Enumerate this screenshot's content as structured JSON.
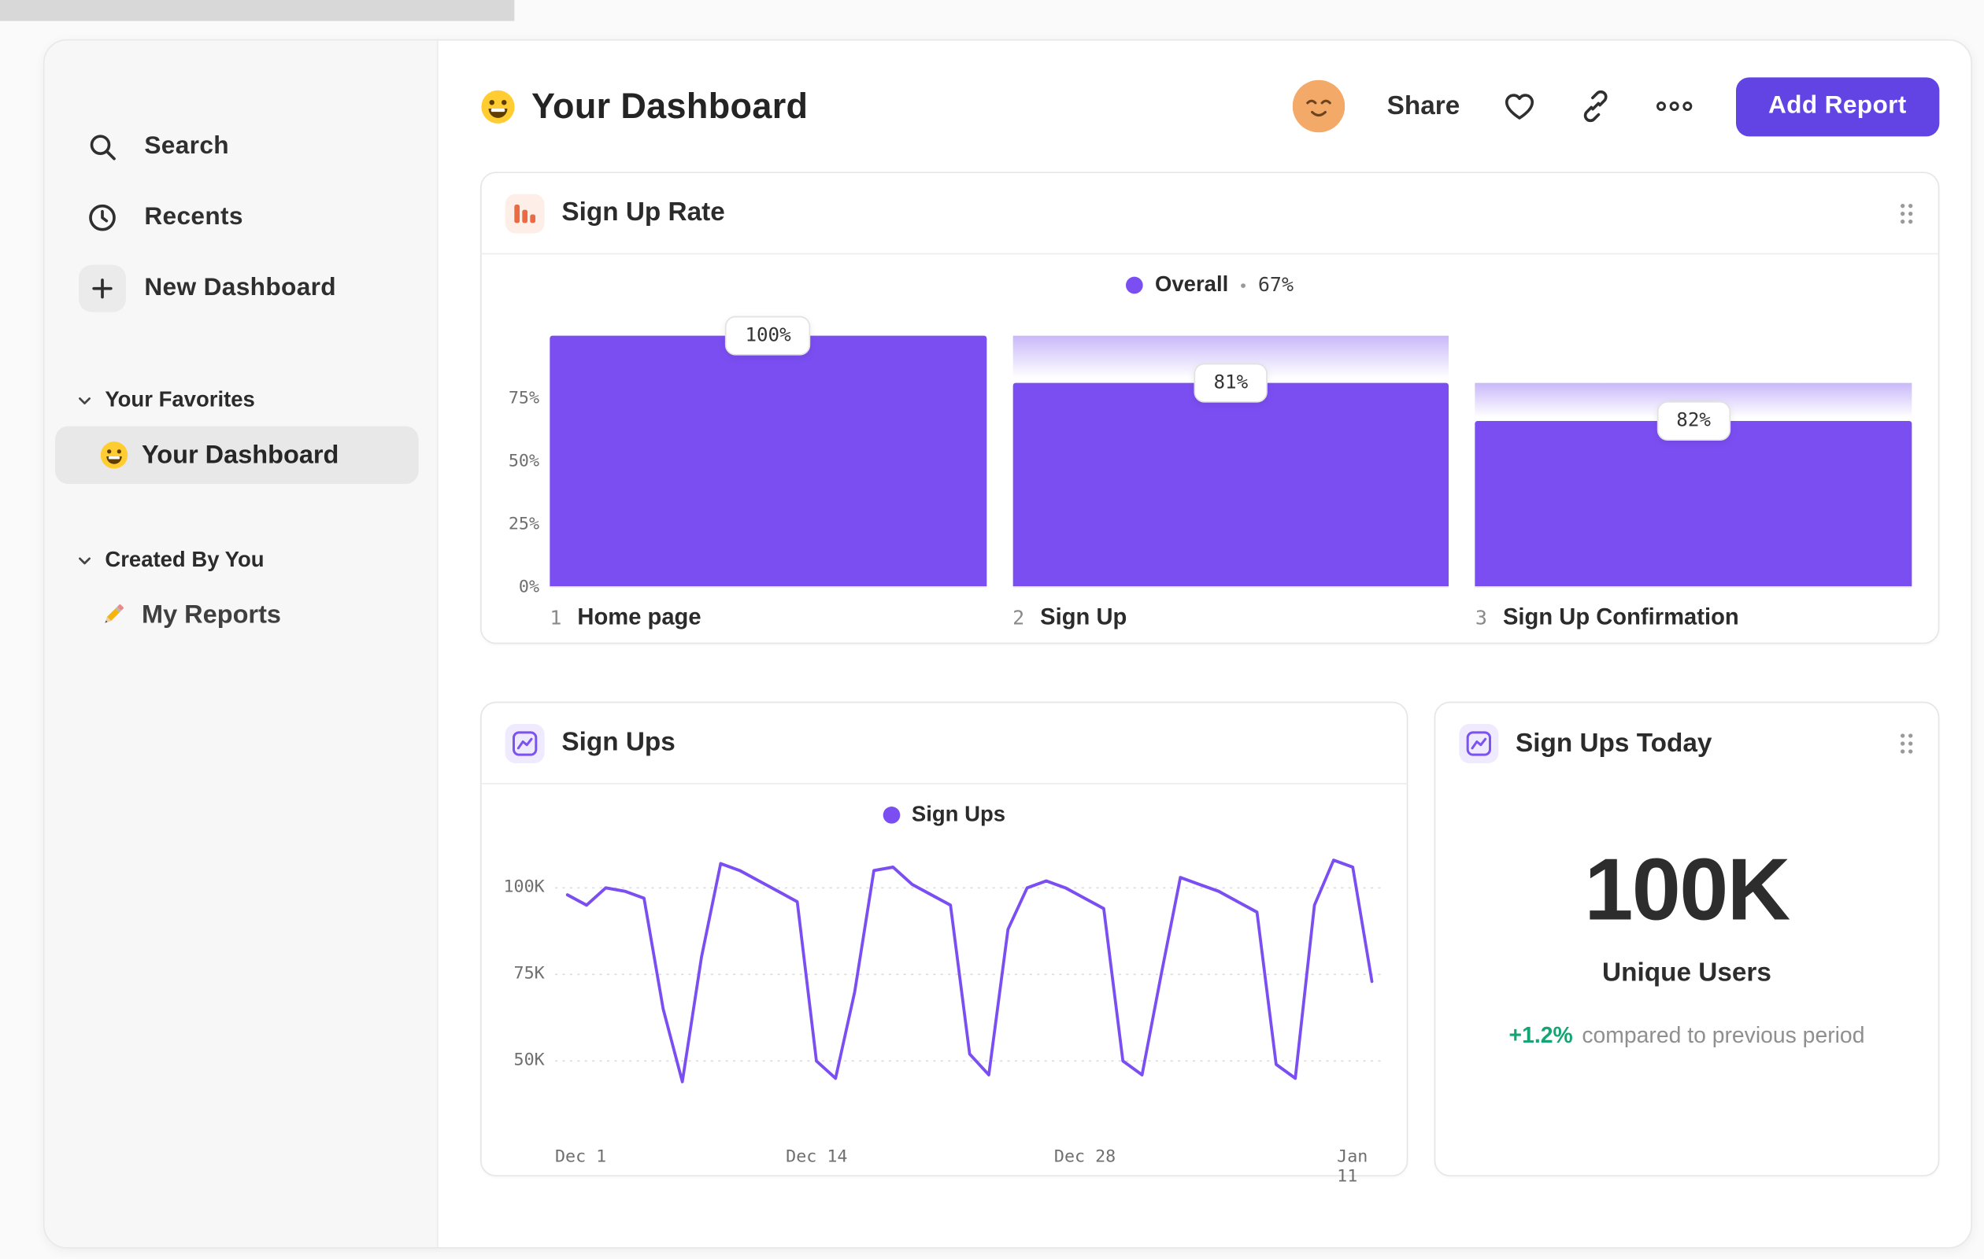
{
  "sidebar": {
    "search": "Search",
    "recents": "Recents",
    "new_dashboard": "New Dashboard",
    "favorites": {
      "title": "Your Favorites",
      "items": [
        {
          "label": "Your Dashboard",
          "selected": true
        }
      ]
    },
    "created_by_you": {
      "title": "Created By You",
      "items": [
        {
          "label": "My Reports"
        }
      ]
    }
  },
  "header": {
    "title": "Your Dashboard",
    "share": "Share",
    "add_report": "Add Report"
  },
  "cards": {
    "funnel": {
      "title": "Sign Up Rate",
      "legend": {
        "label": "Overall",
        "separator": "•",
        "value": "67%"
      },
      "y_ticks": [
        "75%",
        "50%",
        "25%",
        "0%"
      ],
      "steps": [
        {
          "num": "1",
          "name": "Home page",
          "chip": "100%",
          "abs_pct": 100,
          "prev_abs_pct": 100
        },
        {
          "num": "2",
          "name": "Sign Up",
          "chip": "81%",
          "abs_pct": 81,
          "prev_abs_pct": 100
        },
        {
          "num": "3",
          "name": "Sign Up Confirmation",
          "chip": "82%",
          "abs_pct": 66,
          "prev_abs_pct": 81
        }
      ]
    },
    "line": {
      "title": "Sign Ups",
      "legend": {
        "label": "Sign Ups"
      },
      "y_ticks": [
        "100K",
        "75K",
        "50K"
      ],
      "x_ticks": [
        "Dec 1",
        "Dec 14",
        "Dec 28",
        "Jan 11"
      ]
    },
    "today": {
      "title": "Sign Ups Today",
      "value": "100K",
      "label": "Unique Users",
      "delta": "+1.2%",
      "delta_note": "compared to previous period"
    }
  },
  "colors": {
    "accent_purple": "#6243e4",
    "series_purple": "#7b4ef2",
    "funnel_icon_orange": "#e96a43",
    "delta_green": "#13a574"
  },
  "chart_data": [
    {
      "type": "bar",
      "subtype": "funnel",
      "title": "Sign Up Rate",
      "legend": "Overall",
      "overall_conversion_pct": 67,
      "ylim": [
        0,
        100
      ],
      "y_tick_labels": [
        "0%",
        "25%",
        "50%",
        "75%"
      ],
      "steps": [
        {
          "step": 1,
          "name": "Home page",
          "conversion_from_previous_pct": 100,
          "overall_pct": 100
        },
        {
          "step": 2,
          "name": "Sign Up",
          "conversion_from_previous_pct": 81,
          "overall_pct": 81
        },
        {
          "step": 3,
          "name": "Sign Up Confirmation",
          "conversion_from_previous_pct": 82,
          "overall_pct": 66
        }
      ]
    },
    {
      "type": "line",
      "title": "Sign Ups",
      "x_tick_labels": [
        "Dec 1",
        "Dec 14",
        "Dec 28",
        "Jan 11"
      ],
      "y_tick_labels": [
        "50K",
        "75K",
        "100K"
      ],
      "grid": "horizontal-dotted",
      "legend_position": "top-center",
      "series": [
        {
          "name": "Sign Ups",
          "color": "#7b4ef2",
          "unit": "users (thousands)",
          "values_thousands": [
            98,
            95,
            100,
            99,
            97,
            65,
            44,
            80,
            107,
            105,
            102,
            99,
            96,
            50,
            45,
            70,
            105,
            106,
            101,
            98,
            95,
            52,
            46,
            88,
            100,
            102,
            100,
            97,
            94,
            50,
            46,
            75,
            103,
            101,
            99,
            96,
            93,
            49,
            45,
            95,
            108,
            106,
            73
          ]
        }
      ]
    },
    {
      "type": "big-number",
      "title": "Sign Ups Today",
      "value": "100K",
      "label": "Unique Users",
      "delta_pct": "+1.2%",
      "comparison": "compared to previous period"
    }
  ]
}
